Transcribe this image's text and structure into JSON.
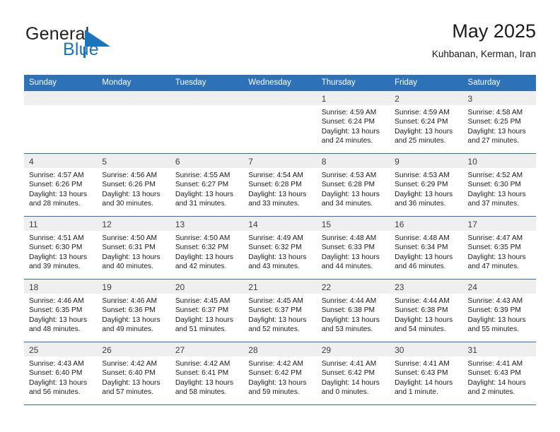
{
  "brand": {
    "name_top": "General",
    "name_bottom": "Blue",
    "accent_color": "#1b75bc",
    "dark_color": "#231f20"
  },
  "header": {
    "title": "May 2025",
    "subtitle": "Kuhbanan, Kerman, Iran"
  },
  "theme": {
    "header_bg": "#2d72b8",
    "header_text": "#ffffff",
    "daynum_band_bg": "#efefef",
    "cell_bg": "#ffffff",
    "rule_color": "#2d72b8"
  },
  "weekday_headers": [
    "Sunday",
    "Monday",
    "Tuesday",
    "Wednesday",
    "Thursday",
    "Friday",
    "Saturday"
  ],
  "weeks": [
    [
      {
        "day": "",
        "lines": []
      },
      {
        "day": "",
        "lines": []
      },
      {
        "day": "",
        "lines": []
      },
      {
        "day": "",
        "lines": []
      },
      {
        "day": "1",
        "lines": [
          "Sunrise: 4:59 AM",
          "Sunset: 6:24 PM",
          "Daylight: 13 hours",
          "and 24 minutes."
        ]
      },
      {
        "day": "2",
        "lines": [
          "Sunrise: 4:59 AM",
          "Sunset: 6:24 PM",
          "Daylight: 13 hours",
          "and 25 minutes."
        ]
      },
      {
        "day": "3",
        "lines": [
          "Sunrise: 4:58 AM",
          "Sunset: 6:25 PM",
          "Daylight: 13 hours",
          "and 27 minutes."
        ]
      }
    ],
    [
      {
        "day": "4",
        "lines": [
          "Sunrise: 4:57 AM",
          "Sunset: 6:26 PM",
          "Daylight: 13 hours",
          "and 28 minutes."
        ]
      },
      {
        "day": "5",
        "lines": [
          "Sunrise: 4:56 AM",
          "Sunset: 6:26 PM",
          "Daylight: 13 hours",
          "and 30 minutes."
        ]
      },
      {
        "day": "6",
        "lines": [
          "Sunrise: 4:55 AM",
          "Sunset: 6:27 PM",
          "Daylight: 13 hours",
          "and 31 minutes."
        ]
      },
      {
        "day": "7",
        "lines": [
          "Sunrise: 4:54 AM",
          "Sunset: 6:28 PM",
          "Daylight: 13 hours",
          "and 33 minutes."
        ]
      },
      {
        "day": "8",
        "lines": [
          "Sunrise: 4:53 AM",
          "Sunset: 6:28 PM",
          "Daylight: 13 hours",
          "and 34 minutes."
        ]
      },
      {
        "day": "9",
        "lines": [
          "Sunrise: 4:53 AM",
          "Sunset: 6:29 PM",
          "Daylight: 13 hours",
          "and 36 minutes."
        ]
      },
      {
        "day": "10",
        "lines": [
          "Sunrise: 4:52 AM",
          "Sunset: 6:30 PM",
          "Daylight: 13 hours",
          "and 37 minutes."
        ]
      }
    ],
    [
      {
        "day": "11",
        "lines": [
          "Sunrise: 4:51 AM",
          "Sunset: 6:30 PM",
          "Daylight: 13 hours",
          "and 39 minutes."
        ]
      },
      {
        "day": "12",
        "lines": [
          "Sunrise: 4:50 AM",
          "Sunset: 6:31 PM",
          "Daylight: 13 hours",
          "and 40 minutes."
        ]
      },
      {
        "day": "13",
        "lines": [
          "Sunrise: 4:50 AM",
          "Sunset: 6:32 PM",
          "Daylight: 13 hours",
          "and 42 minutes."
        ]
      },
      {
        "day": "14",
        "lines": [
          "Sunrise: 4:49 AM",
          "Sunset: 6:32 PM",
          "Daylight: 13 hours",
          "and 43 minutes."
        ]
      },
      {
        "day": "15",
        "lines": [
          "Sunrise: 4:48 AM",
          "Sunset: 6:33 PM",
          "Daylight: 13 hours",
          "and 44 minutes."
        ]
      },
      {
        "day": "16",
        "lines": [
          "Sunrise: 4:48 AM",
          "Sunset: 6:34 PM",
          "Daylight: 13 hours",
          "and 46 minutes."
        ]
      },
      {
        "day": "17",
        "lines": [
          "Sunrise: 4:47 AM",
          "Sunset: 6:35 PM",
          "Daylight: 13 hours",
          "and 47 minutes."
        ]
      }
    ],
    [
      {
        "day": "18",
        "lines": [
          "Sunrise: 4:46 AM",
          "Sunset: 6:35 PM",
          "Daylight: 13 hours",
          "and 48 minutes."
        ]
      },
      {
        "day": "19",
        "lines": [
          "Sunrise: 4:46 AM",
          "Sunset: 6:36 PM",
          "Daylight: 13 hours",
          "and 49 minutes."
        ]
      },
      {
        "day": "20",
        "lines": [
          "Sunrise: 4:45 AM",
          "Sunset: 6:37 PM",
          "Daylight: 13 hours",
          "and 51 minutes."
        ]
      },
      {
        "day": "21",
        "lines": [
          "Sunrise: 4:45 AM",
          "Sunset: 6:37 PM",
          "Daylight: 13 hours",
          "and 52 minutes."
        ]
      },
      {
        "day": "22",
        "lines": [
          "Sunrise: 4:44 AM",
          "Sunset: 6:38 PM",
          "Daylight: 13 hours",
          "and 53 minutes."
        ]
      },
      {
        "day": "23",
        "lines": [
          "Sunrise: 4:44 AM",
          "Sunset: 6:38 PM",
          "Daylight: 13 hours",
          "and 54 minutes."
        ]
      },
      {
        "day": "24",
        "lines": [
          "Sunrise: 4:43 AM",
          "Sunset: 6:39 PM",
          "Daylight: 13 hours",
          "and 55 minutes."
        ]
      }
    ],
    [
      {
        "day": "25",
        "lines": [
          "Sunrise: 4:43 AM",
          "Sunset: 6:40 PM",
          "Daylight: 13 hours",
          "and 56 minutes."
        ]
      },
      {
        "day": "26",
        "lines": [
          "Sunrise: 4:42 AM",
          "Sunset: 6:40 PM",
          "Daylight: 13 hours",
          "and 57 minutes."
        ]
      },
      {
        "day": "27",
        "lines": [
          "Sunrise: 4:42 AM",
          "Sunset: 6:41 PM",
          "Daylight: 13 hours",
          "and 58 minutes."
        ]
      },
      {
        "day": "28",
        "lines": [
          "Sunrise: 4:42 AM",
          "Sunset: 6:42 PM",
          "Daylight: 13 hours",
          "and 59 minutes."
        ]
      },
      {
        "day": "29",
        "lines": [
          "Sunrise: 4:41 AM",
          "Sunset: 6:42 PM",
          "Daylight: 14 hours",
          "and 0 minutes."
        ]
      },
      {
        "day": "30",
        "lines": [
          "Sunrise: 4:41 AM",
          "Sunset: 6:43 PM",
          "Daylight: 14 hours",
          "and 1 minute."
        ]
      },
      {
        "day": "31",
        "lines": [
          "Sunrise: 4:41 AM",
          "Sunset: 6:43 PM",
          "Daylight: 14 hours",
          "and 2 minutes."
        ]
      }
    ]
  ]
}
